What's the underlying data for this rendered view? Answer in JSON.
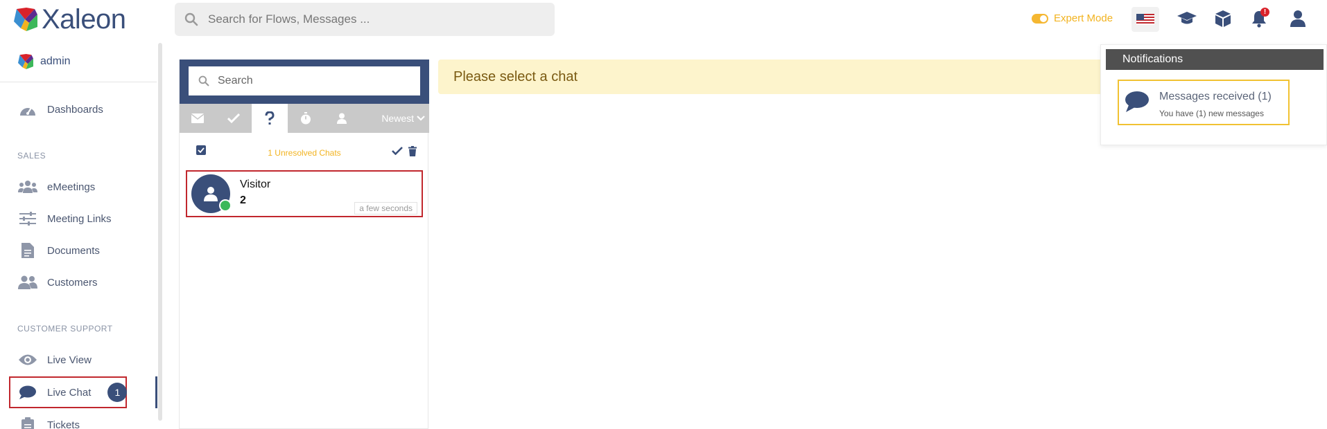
{
  "app": {
    "brand": "Xaleon"
  },
  "header": {
    "search_placeholder": "Search for Flows, Messages ...",
    "expert_mode_label": "Expert Mode",
    "notification_count": "!"
  },
  "sidebar": {
    "user": "admin",
    "items": [
      {
        "label": "Dashboards",
        "icon": "gauge-icon"
      },
      {
        "label": "eMeetings",
        "icon": "users-icon"
      },
      {
        "label": "Meeting Links",
        "icon": "sliders-icon"
      },
      {
        "label": "Documents",
        "icon": "document-icon"
      },
      {
        "label": "Customers",
        "icon": "customers-icon"
      },
      {
        "label": "Live View",
        "icon": "eye-icon"
      },
      {
        "label": "Live Chat",
        "icon": "chat-bubble-icon",
        "badge": "1"
      },
      {
        "label": "Tickets",
        "icon": "ticket-icon"
      }
    ],
    "sections": {
      "sales": "SALES",
      "support": "CUSTOMER SUPPORT"
    }
  },
  "chat_list": {
    "search_placeholder": "Search",
    "sort_label": "Newest",
    "unresolved_label": "1 Unresolved Chats",
    "items": [
      {
        "name": "Visitor",
        "sub": "2",
        "time": "a few seconds"
      }
    ]
  },
  "main": {
    "placeholder": "Please select a chat"
  },
  "notifications": {
    "title": "Notifications",
    "items": [
      {
        "title": "Messages received (1)",
        "desc": "You have (1) new messages"
      }
    ]
  },
  "colors": {
    "brand": "#3a4f7a",
    "accent": "#f2b320",
    "highlight": "#c1272d"
  }
}
